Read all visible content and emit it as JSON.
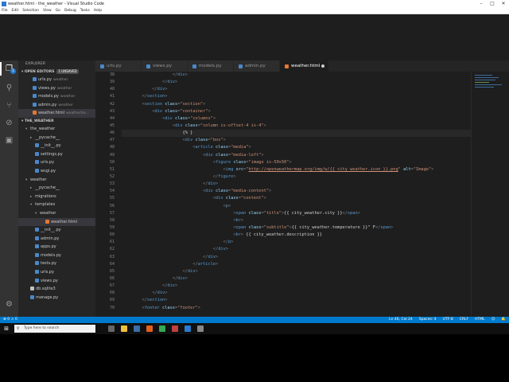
{
  "window": {
    "title": "weather.html - the_weather - Visual Studio Code"
  },
  "menu": [
    "File",
    "Edit",
    "Selection",
    "View",
    "Go",
    "Debug",
    "Tasks",
    "Help"
  ],
  "sidebar": {
    "header": "EXPLORER",
    "open_editors_label": "OPEN EDITORS",
    "open_editors_count": "1 UNSAVED",
    "open_editors": [
      {
        "name": "urls.py",
        "dir": "weather"
      },
      {
        "name": "views.py",
        "dir": "weather"
      },
      {
        "name": "models.py",
        "dir": "weather"
      },
      {
        "name": "admin.py",
        "dir": "weather"
      },
      {
        "name": "weather.html",
        "dir": "weather\\te..."
      }
    ],
    "project_label": "THE_WEATHER",
    "tree": [
      {
        "name": "the_weather"
      },
      {
        "name": "__pycache__"
      },
      {
        "name": "__init__.py"
      },
      {
        "name": "settings.py"
      },
      {
        "name": "urls.py"
      },
      {
        "name": "wsgi.py"
      },
      {
        "name": "weather"
      },
      {
        "name": "__pycache__"
      },
      {
        "name": "migrations"
      },
      {
        "name": "templates"
      },
      {
        "name": "weather"
      },
      {
        "name": "weather.html"
      },
      {
        "name": "__init__.py"
      },
      {
        "name": "admin.py"
      },
      {
        "name": "apps.py"
      },
      {
        "name": "models.py"
      },
      {
        "name": "tests.py"
      },
      {
        "name": "urls.py"
      },
      {
        "name": "views.py"
      },
      {
        "name": "db.sqlite3"
      },
      {
        "name": "manage.py"
      }
    ]
  },
  "tabs": [
    {
      "label": "urls.py"
    },
    {
      "label": "views.py"
    },
    {
      "label": "models.py"
    },
    {
      "label": "admin.py"
    },
    {
      "label": "weather.html"
    }
  ],
  "editor": {
    "line_numbers": [
      "38",
      "39",
      "40",
      "41",
      "42",
      "43",
      "44",
      "45",
      "46",
      "47",
      "48",
      "49",
      "50",
      "51",
      "52",
      "53",
      "54",
      "55",
      "56",
      "57",
      "58",
      "59",
      "60",
      "61",
      "62",
      "63",
      "64",
      "65",
      "66",
      "67",
      "68",
      "69",
      "70"
    ]
  },
  "status": {
    "errors": "0",
    "warnings": "0",
    "cursor": "Ln 46, Col 24",
    "spaces": "Spaces: 4",
    "encoding": "UTF-8",
    "eol": "CRLF",
    "language": "HTML"
  },
  "taskbar": {
    "search_placeholder": "Type here to search"
  }
}
